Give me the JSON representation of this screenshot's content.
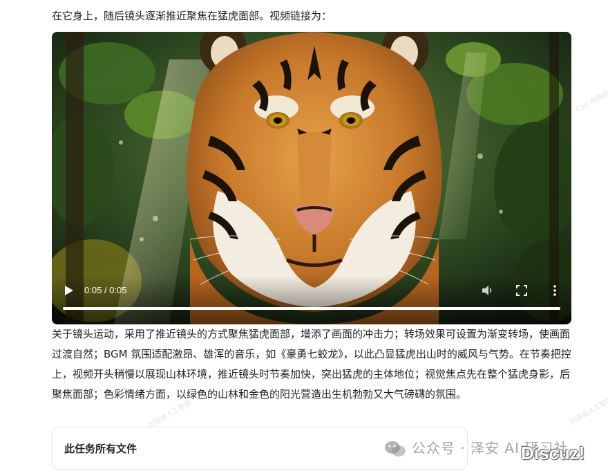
{
  "article": {
    "intro_text": "在它身上，随后镜头逐渐推近聚焦在猛虎面部。视频链接为：",
    "body_text": "关于镜头运动，采用了推近镜头的方式聚焦猛虎面部，增添了画面的冲击力；转场效果可设置为渐变转场，使画面过渡自然；BGM 氛围适配激昂、雄浑的音乐，如《豪勇七蛟龙》，以此凸显猛虎出山时的威风与气势。在节奏把控上，视频开头稍慢以展现山林环境，推近镜头时节奏加快，突出猛虎的主体地位；视觉焦点先在整个猛虎身影，后聚焦面部；色彩情绪方面，以绿色的山林和金色的阳光营造出生机勃勃又大气磅礴的氛围。"
  },
  "video_player": {
    "time_display": "0:05 / 0:05",
    "progress_fraction": 1.0,
    "icons": {
      "play": "play-icon",
      "volume": "volume-muted-icon",
      "fullscreen": "fullscreen-icon",
      "more": "more-vertical-icon"
    }
  },
  "files_card": {
    "title": "此任务所有文件"
  },
  "watermarks": {
    "source_text": "公众号 · 泽安 AI 研习社",
    "discuz_text": "Discuz!",
    "faint_1": "Cao 内容由人工智能",
    "faint_2": "内容由人工智能",
    "faint_3": "内容由人工智能"
  },
  "colors": {
    "text": "#222222",
    "card_border": "#e4e4e4",
    "progress_fill": "#ffffff"
  }
}
